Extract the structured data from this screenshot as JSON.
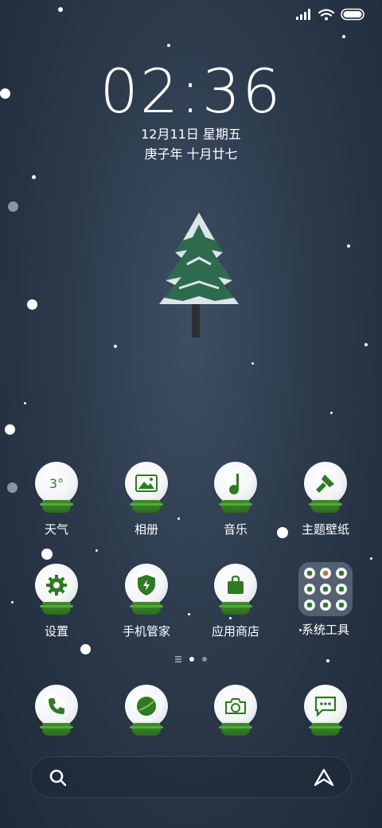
{
  "status_bar": {
    "icons": [
      "signal-icon",
      "wifi-icon",
      "battery-icon"
    ]
  },
  "clock": {
    "time": "02:36",
    "date": "12月11日 星期五",
    "lunar": "庚子年 十月廿七"
  },
  "wallpaper": {
    "subject": "snowy-pine-tree"
  },
  "apps": {
    "weather": {
      "label": "天气",
      "temp": "3°"
    },
    "gallery": {
      "label": "相册"
    },
    "music": {
      "label": "音乐"
    },
    "themes": {
      "label": "主题壁纸"
    },
    "settings": {
      "label": "设置"
    },
    "security": {
      "label": "手机管家"
    },
    "store": {
      "label": "应用商店"
    },
    "tools_folder": {
      "label": "系统工具"
    }
  },
  "dock": {
    "items": [
      {
        "icon": "phone-icon"
      },
      {
        "icon": "browser-icon"
      },
      {
        "icon": "camera-icon"
      },
      {
        "icon": "messages-icon"
      }
    ]
  },
  "pager": {
    "pages": 2,
    "active": 1
  },
  "search": {
    "icons": [
      "search-icon",
      "assistant-icon"
    ]
  },
  "colors": {
    "accent_green": "#2f7a22",
    "globe_white": "#f3f5f7",
    "background": "#2c3a4c"
  }
}
